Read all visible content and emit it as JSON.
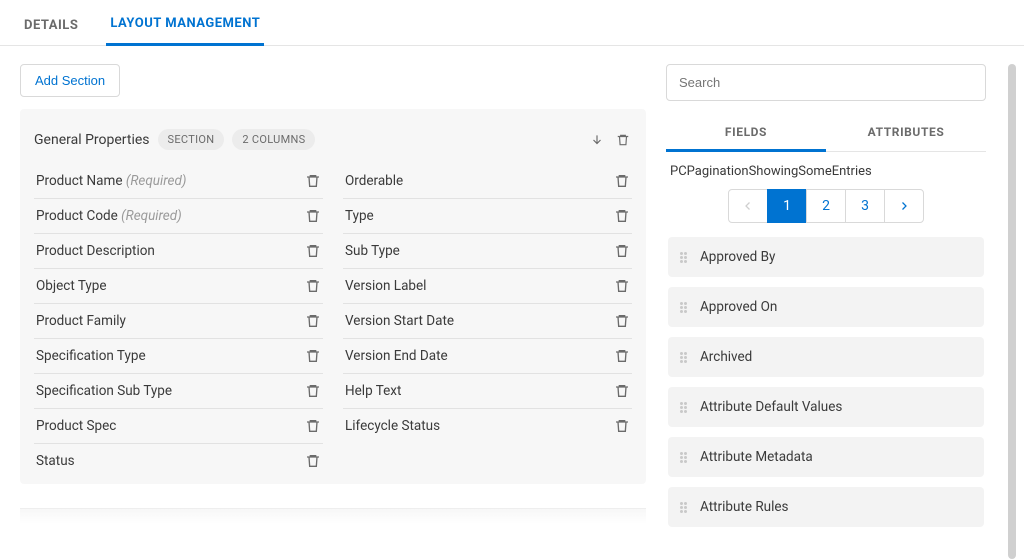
{
  "tabs": {
    "details": "DETAILS",
    "layout": "LAYOUT MANAGEMENT"
  },
  "addSection": "Add Section",
  "section": {
    "title": "General Properties",
    "sectionBadge": "SECTION",
    "columnsBadge": "2 COLUMNS",
    "col1": [
      {
        "label": "Product Name",
        "required": "(Required)"
      },
      {
        "label": "Product Code",
        "required": "(Required)"
      },
      {
        "label": "Product Description"
      },
      {
        "label": "Object Type"
      },
      {
        "label": "Product Family"
      },
      {
        "label": "Specification Type"
      },
      {
        "label": "Specification Sub Type"
      },
      {
        "label": "Product Spec"
      },
      {
        "label": "Status"
      }
    ],
    "col2": [
      {
        "label": "Orderable"
      },
      {
        "label": "Type"
      },
      {
        "label": "Sub Type"
      },
      {
        "label": "Version Label"
      },
      {
        "label": "Version Start Date"
      },
      {
        "label": "Version End Date"
      },
      {
        "label": "Help Text"
      },
      {
        "label": "Lifecycle Status"
      }
    ]
  },
  "rightPanel": {
    "searchPlaceholder": "Search",
    "tabs": {
      "fields": "FIELDS",
      "attributes": "ATTRIBUTES"
    },
    "paginationLabel": "PCPaginationShowingSomeEntries",
    "pages": [
      "1",
      "2",
      "3"
    ],
    "currentPage": "1",
    "available": [
      "Approved By",
      "Approved On",
      "Archived",
      "Attribute Default Values",
      "Attribute Metadata",
      "Attribute Rules"
    ]
  }
}
